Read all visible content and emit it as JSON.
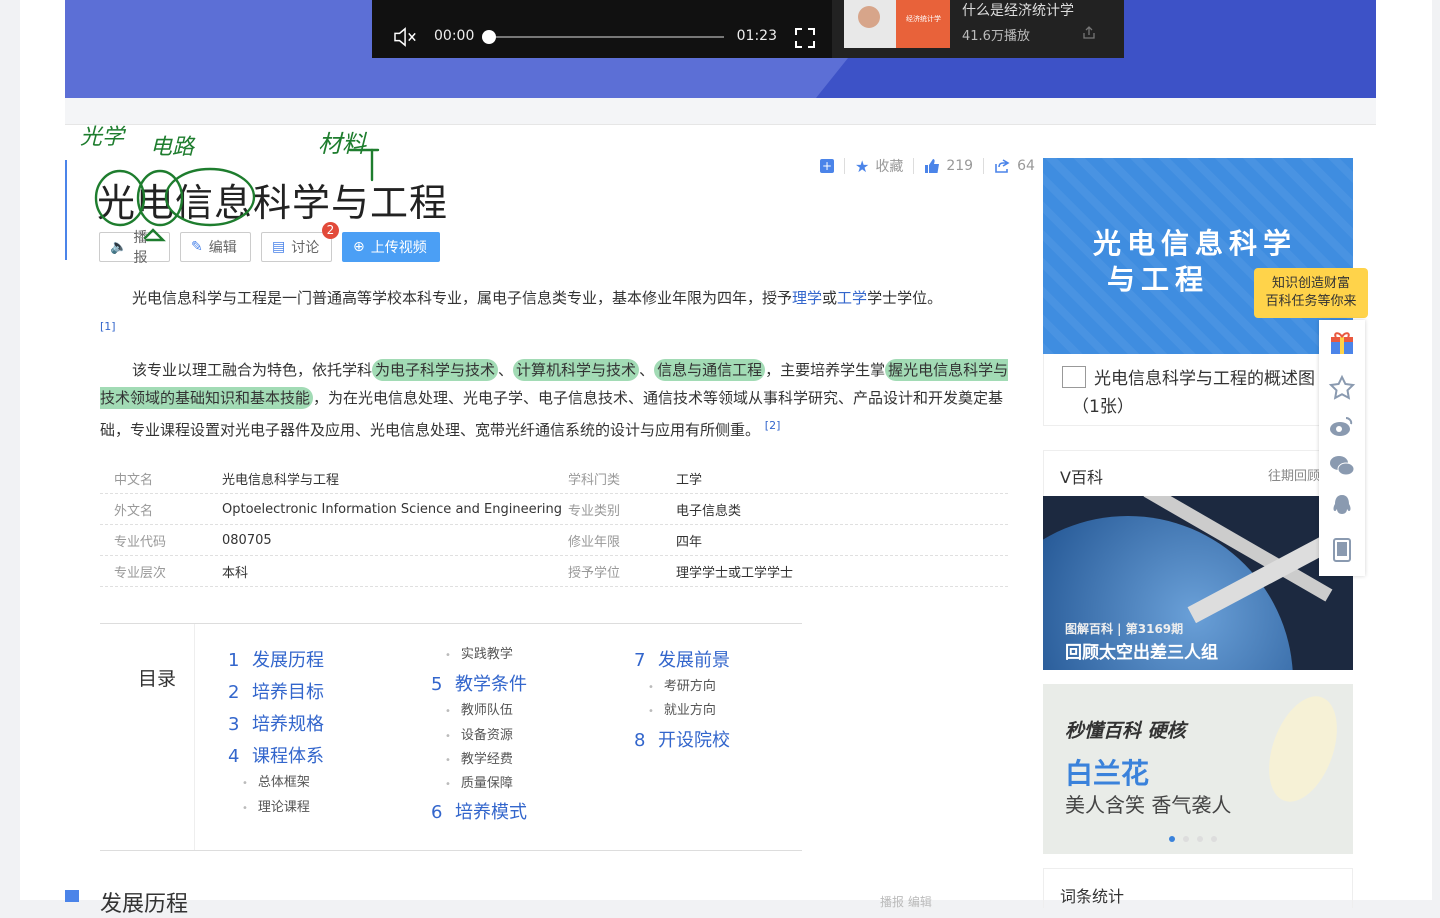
{
  "player": {
    "time_current": "00:00",
    "time_total": "01:23",
    "progress": 0.0,
    "rec_title": "什么是经济统计学",
    "rec_plays": "41.6万播放",
    "rec_thumb_text": "经济统计学"
  },
  "entry": {
    "title": "光电信息科学与工程",
    "favorite_label": "收藏",
    "like_count": "219",
    "share_count": "64",
    "buttons": {
      "play": "播报",
      "edit": "编辑",
      "discuss": "讨论",
      "discuss_badge": "2",
      "upload": "上传视频"
    }
  },
  "paragraph1": {
    "text_a": "光电信息科学与工程是一门普通高等学校本科专业，属电子信息类专业，基本修业年限为四年，授予",
    "link_science": "理学",
    "text_or": "或",
    "link_engineering": "工学",
    "text_b": "学士学位。",
    "ref": "[1]"
  },
  "paragraph2": {
    "text_a": "该专业以理工融合为特色，依托学科",
    "hl1": "为电子科学与技术",
    "sep1": "、",
    "hl2": "计算机科学与技术",
    "sep2": "、",
    "hl3": "信息与通信工程",
    "text_b": "，主要培养学生掌",
    "hl4": "握光电信息科学与技术领域的基础知识和基本技能",
    "text_c": "，为在光电信息处理、光电子学、电子信息技术、通信技术等领域从事科学研究、产品设计和开发奠定基础，专业课程设置对光电子器件及应用、光电信息处理、宽带光纤通信系统的设计与应用有所侧重。",
    "ref": "[2]"
  },
  "infobox": [
    {
      "k1": "中文名",
      "v1": "光电信息科学与工程",
      "k2": "学科门类",
      "v2": "工学"
    },
    {
      "k1": "外文名",
      "v1": "Optoelectronic Information Science and Engineering",
      "k2": "专业类别",
      "v2": "电子信息类"
    },
    {
      "k1": "专业代码",
      "v1": "080705",
      "k2": "修业年限",
      "v2": "四年"
    },
    {
      "k1": "专业层次",
      "v1": "本科",
      "k2": "授予学位",
      "v2": "理学学士或工学学士"
    }
  ],
  "toc": {
    "heading": "目录",
    "items": [
      {
        "num": "1",
        "label": "发展历程"
      },
      {
        "num": "2",
        "label": "培养目标"
      },
      {
        "num": "3",
        "label": "培养规格"
      },
      {
        "num": "4",
        "label": "课程体系"
      },
      {
        "num": "5",
        "label": "教学条件"
      },
      {
        "num": "6",
        "label": "培养模式"
      },
      {
        "num": "7",
        "label": "发展前景"
      },
      {
        "num": "8",
        "label": "开设院校"
      }
    ],
    "sub4": [
      "总体框架",
      "理论课程",
      "实践教学"
    ],
    "sub5": [
      "教师队伍",
      "设备资源",
      "教学经费",
      "质量保障"
    ],
    "sub7": [
      "考研方向",
      "就业方向"
    ]
  },
  "sidebar_right": {
    "hero_line1": "光电信息科学",
    "hero_line2": "与工程",
    "tip_line1": "知识创造财富",
    "tip_line2": "百科任务等你来",
    "album_title": "光电信息科学与工程的概述图",
    "album_count": "（1张）",
    "vbaike_label": "V百科",
    "vbaike_more": "往期回顾",
    "space_caption1": "图解百科 | 第3169期",
    "space_caption2": "回顾太空出差三人组",
    "flower_brand": "秒懂百科 硬核",
    "flower_name": "白兰花",
    "flower_slogan": "美人含笑 香气袭人",
    "stats_label": "词条统计"
  },
  "share_icons": [
    "gift-icon",
    "star-icon",
    "weibo-icon",
    "wechat-icon",
    "qq-icon",
    "tablet-icon"
  ],
  "bottom": {
    "section_title": "发展历程",
    "actions": "播报   编辑"
  },
  "annotations": {
    "note_guang": "光学",
    "note_dianlu": "电路",
    "note_cailiao": "材料"
  },
  "colors": {
    "accent": "#4b84e9",
    "link": "#3366cc",
    "highlight": "#56be78",
    "banner": "#5c6fd6",
    "tip": "#ffd34a"
  }
}
